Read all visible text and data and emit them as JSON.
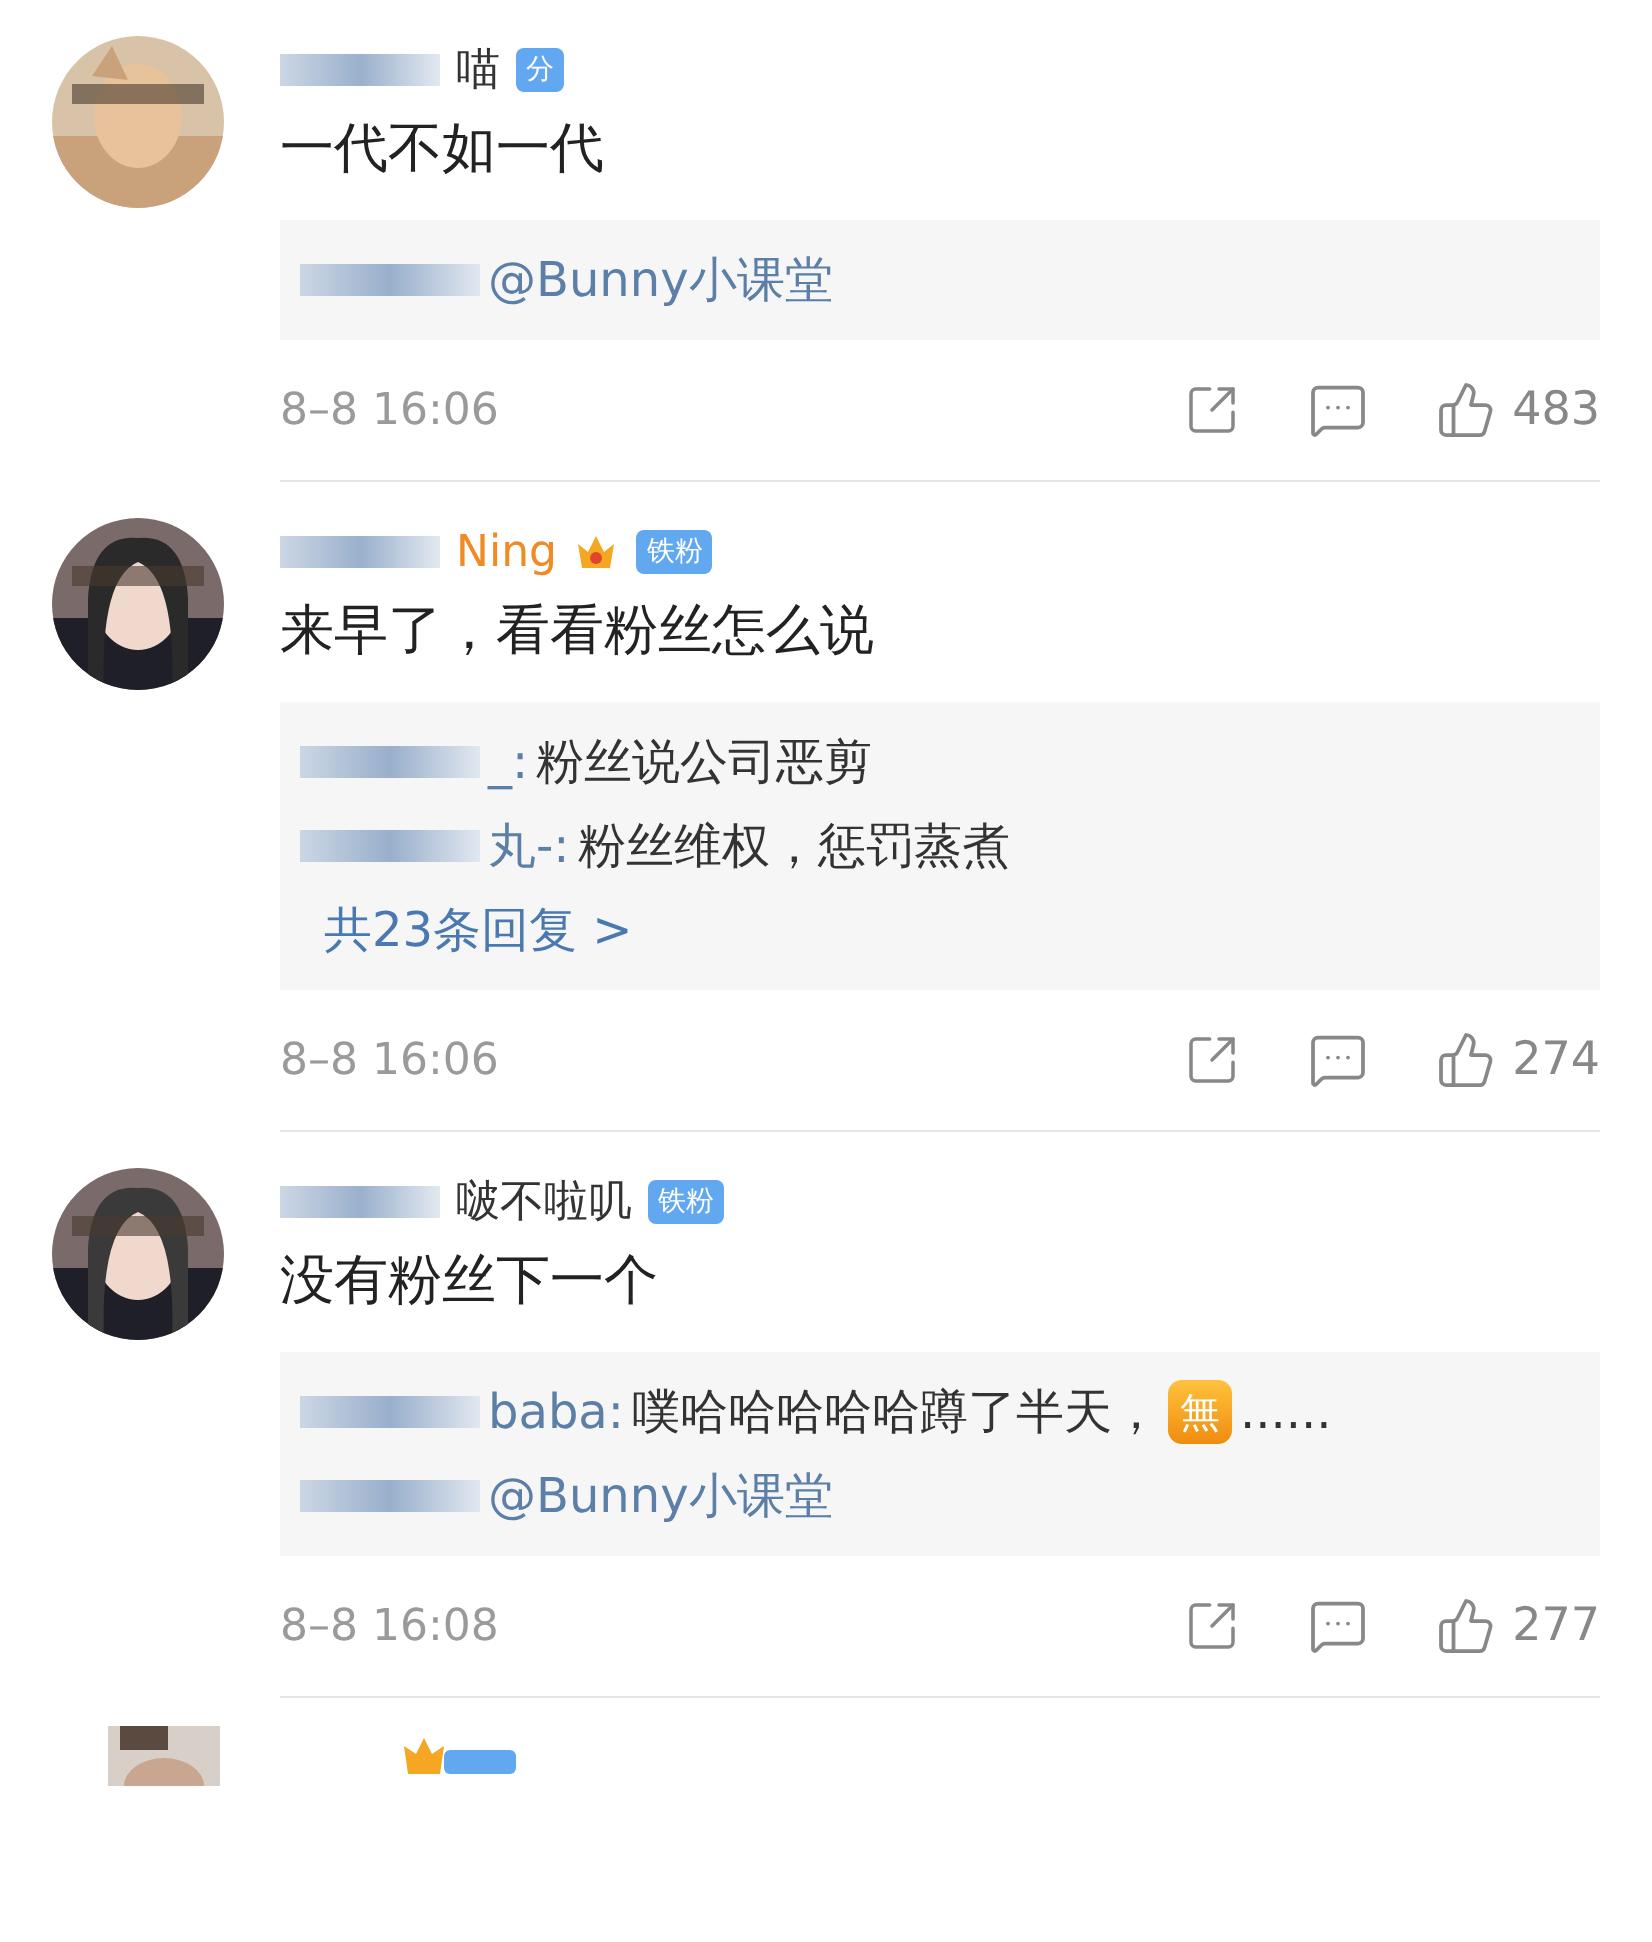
{
  "comments": [
    {
      "name": "喵",
      "vip": false,
      "redacted": true,
      "badge": "分",
      "text": "一代不如一代",
      "replies": [
        {
          "body": "@Bunny小课堂",
          "redacted": true
        }
      ],
      "time": "8–8 16:06",
      "likes": "483"
    },
    {
      "name": "Ning",
      "vip": true,
      "redacted": true,
      "badge": "铁粉",
      "text": "来早了，看看粉丝怎么说",
      "replies": [
        {
          "author": "_:",
          "body": "粉丝说公司恶剪",
          "redacted": true
        },
        {
          "author": "丸-:",
          "body": "粉丝维权，惩罚蒸煮",
          "redacted": true
        }
      ],
      "more": "共23条回复 >",
      "time": "8–8 16:06",
      "likes": "274"
    },
    {
      "name": "啵不啦叽",
      "vip": false,
      "redacted": true,
      "badge": "铁粉",
      "text": "没有粉丝下一个",
      "replies": [
        {
          "author": "baba:",
          "body": "噗哈哈哈哈哈蹲了半天，",
          "emoji": "無",
          "tail": "......",
          "redacted": true
        },
        {
          "body": "@Bunny小课堂",
          "redacted": true
        }
      ],
      "time": "8–8 16:08",
      "likes": "277"
    }
  ]
}
